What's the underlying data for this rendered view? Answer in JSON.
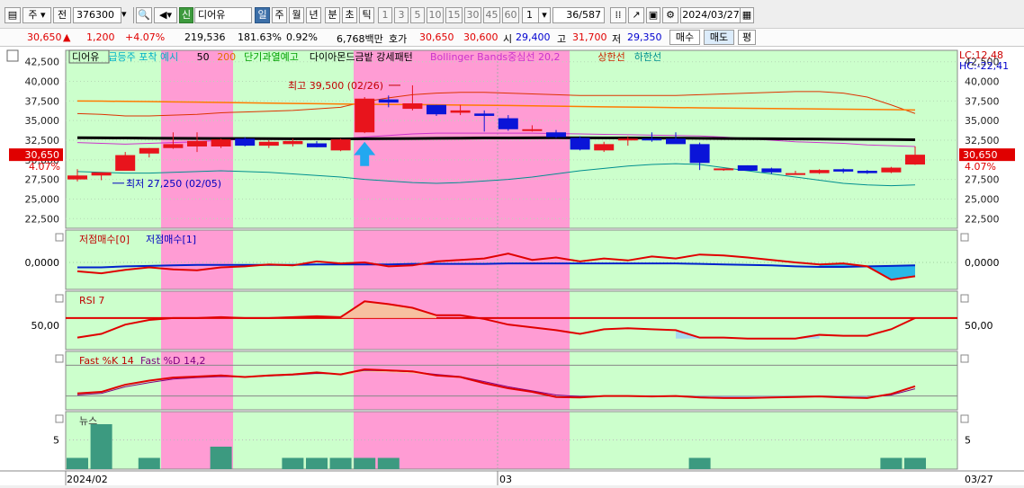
{
  "toolbar": {
    "period_select": "주",
    "prev_label": "전",
    "code": "376300",
    "stock_badge": "신",
    "stock_name": "디어유",
    "tf_buttons": [
      "일",
      "주",
      "월",
      "년",
      "분",
      "초",
      "틱"
    ],
    "tf_active": "일",
    "minute_buttons": [
      "1",
      "3",
      "5",
      "10",
      "15",
      "30",
      "45",
      "60"
    ],
    "multiplier": "1",
    "counter": "36",
    "counter_total": "/587",
    "date": "2024/03/27"
  },
  "info": {
    "price": "30,650",
    "change": "1,200",
    "change_pct": "+4.07%",
    "volume": "219,536",
    "volume_ratio": "181.63%",
    "turnover": "0.92%",
    "amount": "6,768백만",
    "ask_label": "호가",
    "ask1": "30,650",
    "ask2": "30,600",
    "open_label": "시",
    "open": "29,400",
    "high_label": "고",
    "high": "31,700",
    "low_label": "저",
    "low": "29,350",
    "buy_button": "매수",
    "sell_button": "매도",
    "eval_button": "평"
  },
  "chart": {
    "colors": {
      "up": "#e8141c",
      "down": "#0a14d8",
      "pink": "#ff9cd4",
      "green": "#ccffcc",
      "ma50": "#e7a100",
      "ma200": "#ff7a00",
      "bbmid": "#cc33cc",
      "upper": "#dd3300",
      "lower": "#008f8f",
      "vol": "#3c9a80",
      "rsiline": "#e00000"
    },
    "legend": [
      {
        "text": "디어유",
        "color": "#000000"
      },
      {
        "text": "급등주 포착 예시",
        "color": "#00b0c8"
      },
      {
        "text": "50",
        "color": "#000000"
      },
      {
        "text": "200",
        "color": "#e07000"
      },
      {
        "text": "단기과열예고",
        "color": "#00a000"
      },
      {
        "text": "다이아몬드금밭 강세패턴",
        "color": "#000000"
      },
      {
        "text": "Bollinger Bands중심선 20,2",
        "color": "#cc33cc"
      },
      {
        "text": "상한선",
        "color": "#cc2200"
      },
      {
        "text": "하한선",
        "color": "#008f8f"
      }
    ],
    "lc_label": "LC:12,48",
    "hc_label": "HC:-22,41",
    "price_ticks": [
      "42,500",
      "40,000",
      "37,500",
      "35,000",
      "32,500",
      "30,000",
      "27,500",
      "25,000",
      "22,500"
    ],
    "price_ticks_right": [
      "42,500",
      "40,000",
      "37,500",
      "35,000",
      "32,500",
      "27,500",
      "25,000",
      "22,500"
    ],
    "current_price": "30,650",
    "current_pct": "4.07%",
    "high_annotation": "최고 39,500 (02/26)",
    "low_annotation": "최저 27,250 (02/05)",
    "pane2_legend_a": "저점매수[0]",
    "pane2_legend_b": "저점매수[1]",
    "pane2_tick": "0,0000",
    "pane3_legend": "RSI 7",
    "pane3_tick": "50,00",
    "pane4_legend_a": "Fast %K 14",
    "pane4_legend_b": "Fast %D 14,2",
    "pane5_legend": "뉴스",
    "pane5_tick": "5",
    "x_label_start": "2024/02",
    "x_label_mid": "03",
    "x_label_end": "03/27"
  },
  "chart_data": {
    "type": "candlestick",
    "candles": [
      {
        "o": 27500,
        "h": 28800,
        "l": 27250,
        "c": 28000
      },
      {
        "o": 28000,
        "h": 28400,
        "l": 27400,
        "c": 28400
      },
      {
        "o": 28600,
        "h": 31000,
        "l": 28600,
        "c": 30600
      },
      {
        "o": 30800,
        "h": 31500,
        "l": 30300,
        "c": 31500
      },
      {
        "o": 31500,
        "h": 33500,
        "l": 31400,
        "c": 32000
      },
      {
        "o": 31700,
        "h": 33500,
        "l": 31000,
        "c": 32400
      },
      {
        "o": 31700,
        "h": 32700,
        "l": 31500,
        "c": 32600
      },
      {
        "o": 32700,
        "h": 32900,
        "l": 31700,
        "c": 31800
      },
      {
        "o": 31800,
        "h": 32500,
        "l": 31500,
        "c": 32300
      },
      {
        "o": 32000,
        "h": 32700,
        "l": 31700,
        "c": 32400
      },
      {
        "o": 32100,
        "h": 32400,
        "l": 31600,
        "c": 31600
      },
      {
        "o": 31200,
        "h": 32700,
        "l": 31100,
        "c": 32600
      },
      {
        "o": 33500,
        "h": 38000,
        "l": 33400,
        "c": 37800
      },
      {
        "o": 37700,
        "h": 38200,
        "l": 36700,
        "c": 37300
      },
      {
        "o": 36500,
        "h": 39500,
        "l": 36300,
        "c": 37200
      },
      {
        "o": 37000,
        "h": 37000,
        "l": 35600,
        "c": 35800
      },
      {
        "o": 36000,
        "h": 37000,
        "l": 35700,
        "c": 36300
      },
      {
        "o": 35900,
        "h": 36300,
        "l": 33600,
        "c": 35600
      },
      {
        "o": 35300,
        "h": 35700,
        "l": 33700,
        "c": 33900
      },
      {
        "o": 33900,
        "h": 34400,
        "l": 33600,
        "c": 33900
      },
      {
        "o": 33500,
        "h": 33800,
        "l": 32800,
        "c": 32900
      },
      {
        "o": 32800,
        "h": 33000,
        "l": 31200,
        "c": 31300
      },
      {
        "o": 31200,
        "h": 32300,
        "l": 31000,
        "c": 32000
      },
      {
        "o": 32500,
        "h": 33000,
        "l": 31800,
        "c": 32700
      },
      {
        "o": 32700,
        "h": 33500,
        "l": 32300,
        "c": 32500
      },
      {
        "o": 32700,
        "h": 33500,
        "l": 32100,
        "c": 32000
      },
      {
        "o": 32000,
        "h": 32200,
        "l": 28700,
        "c": 29600
      },
      {
        "o": 28700,
        "h": 28900,
        "l": 28600,
        "c": 28900
      },
      {
        "o": 29300,
        "h": 29300,
        "l": 28600,
        "c": 28600
      },
      {
        "o": 28900,
        "h": 29000,
        "l": 28200,
        "c": 28400
      },
      {
        "o": 28300,
        "h": 28600,
        "l": 28100,
        "c": 28300
      },
      {
        "o": 28300,
        "h": 28800,
        "l": 28200,
        "c": 28700
      },
      {
        "o": 28800,
        "h": 28900,
        "l": 28300,
        "c": 28500
      },
      {
        "o": 28600,
        "h": 28700,
        "l": 28200,
        "c": 28300
      },
      {
        "o": 28400,
        "h": 29100,
        "l": 28300,
        "c": 29000
      },
      {
        "o": 29400,
        "h": 31700,
        "l": 29350,
        "c": 30650
      }
    ],
    "ma50": [
      32820,
      32800,
      32780,
      32760,
      32740,
      32730,
      32720,
      32710,
      32700,
      32690,
      32680,
      32670,
      32680,
      32700,
      32720,
      32740,
      32760,
      32780,
      32790,
      32800,
      32810,
      32800,
      32790,
      32780,
      32770,
      32760,
      32740,
      32720,
      32700,
      32680,
      32660,
      32640,
      32620,
      32600,
      32580,
      32560
    ],
    "ma200": [
      37500,
      37480,
      37450,
      37420,
      37390,
      37350,
      37310,
      37270,
      37230,
      37190,
      37150,
      37110,
      37080,
      37060,
      37040,
      37010,
      36980,
      36950,
      36920,
      36880,
      36840,
      36800,
      36760,
      36720,
      36690,
      36660,
      36630,
      36600,
      36570,
      36540,
      36510,
      36480,
      36450,
      36420,
      36390,
      36360
    ],
    "bb_mid": [
      32200,
      32100,
      32000,
      32100,
      32200,
      32300,
      32500,
      32600,
      32600,
      32600,
      32650,
      32700,
      32900,
      33100,
      33300,
      33400,
      33400,
      33400,
      33400,
      33400,
      33350,
      33300,
      33250,
      33200,
      33150,
      33100,
      33050,
      32900,
      32700,
      32500,
      32300,
      32200,
      32100,
      31900,
      31800,
      31700
    ],
    "bb_upper": [
      35900,
      35800,
      35600,
      35600,
      35700,
      35800,
      36000,
      36100,
      36200,
      36300,
      36500,
      36700,
      37400,
      37900,
      38300,
      38500,
      38600,
      38600,
      38500,
      38400,
      38300,
      38200,
      38200,
      38200,
      38200,
      38200,
      38300,
      38400,
      38500,
      38600,
      38700,
      38700,
      38500,
      38000,
      37000,
      35900
    ],
    "bb_lower": [
      28500,
      28400,
      28300,
      28300,
      28400,
      28500,
      28600,
      28500,
      28400,
      28200,
      28000,
      27800,
      27500,
      27300,
      27100,
      27000,
      27100,
      27300,
      27500,
      27800,
      28200,
      28600,
      28900,
      29200,
      29400,
      29500,
      29400,
      29000,
      28600,
      28200,
      27800,
      27400,
      27000,
      26800,
      26700,
      26800
    ],
    "signal0": [
      -0.18,
      -0.22,
      -0.15,
      -0.1,
      -0.14,
      -0.16,
      -0.1,
      -0.08,
      -0.04,
      -0.06,
      0.02,
      -0.02,
      0.0,
      -0.08,
      -0.06,
      0.02,
      0.05,
      0.08,
      0.18,
      0.05,
      0.1,
      0.02,
      0.08,
      0.04,
      0.12,
      0.08,
      0.16,
      0.14,
      0.1,
      0.05,
      0.0,
      -0.04,
      -0.02,
      -0.08,
      -0.35,
      -0.28
    ],
    "signal1": [
      -0.1,
      -0.1,
      -0.08,
      -0.07,
      -0.06,
      -0.05,
      -0.05,
      -0.05,
      -0.05,
      -0.05,
      -0.04,
      -0.04,
      -0.04,
      -0.04,
      -0.03,
      -0.03,
      -0.03,
      -0.03,
      -0.02,
      -0.02,
      -0.02,
      -0.02,
      -0.02,
      -0.02,
      -0.02,
      -0.02,
      -0.03,
      -0.04,
      -0.05,
      -0.06,
      -0.08,
      -0.09,
      -0.09,
      -0.08,
      -0.07,
      -0.06
    ],
    "rsi": [
      34,
      38,
      48,
      53,
      55,
      55,
      56,
      55,
      55,
      56,
      57,
      56,
      73,
      70,
      66,
      58,
      58,
      54,
      48,
      45,
      42,
      38,
      43,
      44,
      43,
      42,
      34,
      34,
      33,
      33,
      33,
      37,
      36,
      36,
      43,
      55
    ],
    "fastk": [
      25,
      28,
      42,
      50,
      56,
      58,
      60,
      57,
      60,
      62,
      66,
      62,
      72,
      70,
      68,
      60,
      57,
      45,
      35,
      28,
      18,
      17,
      20,
      20,
      19,
      20,
      17,
      16,
      16,
      17,
      18,
      19,
      17,
      16,
      24,
      39
    ],
    "fastd": [
      22,
      25,
      38,
      46,
      53,
      56,
      58,
      57,
      59,
      61,
      64,
      63,
      70,
      69,
      67,
      62,
      58,
      48,
      38,
      30,
      22,
      19,
      20,
      20,
      20,
      20,
      18,
      17,
      17,
      17,
      18,
      19,
      18,
      17,
      22,
      34
    ],
    "news": [
      1,
      4,
      0,
      1,
      0,
      0,
      2,
      0,
      0,
      1,
      1,
      1,
      1,
      1,
      0,
      0,
      0,
      0,
      0,
      0,
      0,
      0,
      0,
      0,
      0,
      0,
      1,
      0,
      0,
      0,
      0,
      0,
      0,
      0,
      1,
      1
    ],
    "ylim": [
      21500,
      43500
    ],
    "x_labels": [
      "2024/02",
      "03",
      "03/27"
    ]
  }
}
